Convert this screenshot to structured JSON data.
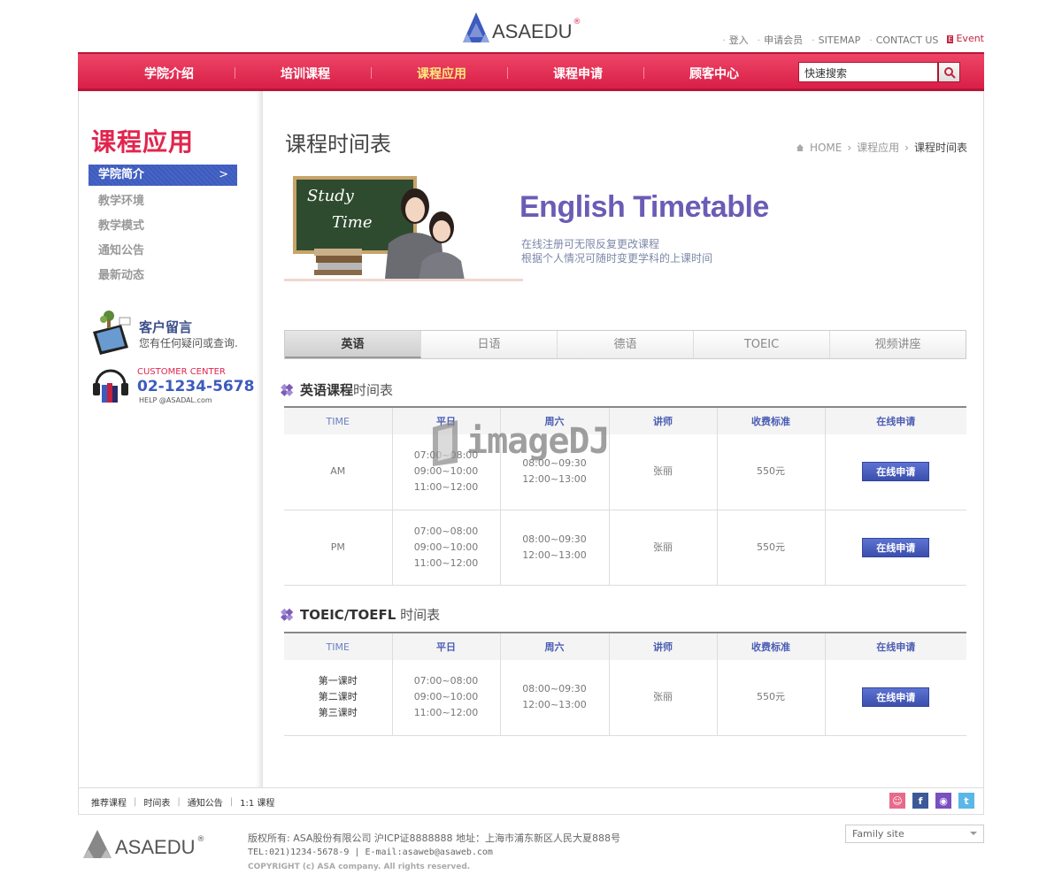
{
  "brand": {
    "name": "ASAEDU",
    "reg": "®"
  },
  "utility": {
    "login": "登入",
    "join": "申请会员",
    "sitemap": "SITEMAP",
    "contact": "CONTACT US",
    "event": "Event"
  },
  "nav": {
    "items": [
      "学院介绍",
      "培训课程",
      "课程应用",
      "课程申请",
      "顾客中心"
    ],
    "active_index": 2,
    "search_placeholder": "快速搜索"
  },
  "sidebar": {
    "title": "课程应用",
    "menu": [
      "学院简介",
      "教学环境",
      "教学模式",
      "通知公告",
      "最新动态"
    ],
    "promo": {
      "title": "客户留言",
      "subtitle": "您有任何疑问或查询."
    },
    "center": {
      "label": "CUSTOMER CENTER",
      "phone": "02-1234-5678",
      "help": "HELP @ASADAL.com"
    }
  },
  "main": {
    "title": "课程时间表",
    "breadcrumb": [
      "HOME",
      "课程应用",
      "课程时间表"
    ],
    "banner": {
      "title": "English Timetable",
      "line1": "在线注册可无限反复更改课程",
      "line2": "根据个人情况可随时变更学科的上课时间",
      "board1": "Study",
      "board2": "Time"
    },
    "tabs": [
      "英语",
      "日语",
      "德语",
      "TOEIC",
      "视频讲座"
    ],
    "active_tab": 0,
    "section1": {
      "title_bold": "英语课程",
      "title_lite": "时间表",
      "headers": [
        "TIME",
        "平日",
        "周六",
        "讲师",
        "收费标准",
        "在线申请"
      ],
      "rows": [
        {
          "time": "AM",
          "weekday": [
            "07:00~08:00",
            "09:00~10:00",
            "11:00~12:00"
          ],
          "saturday": [
            "08:00~09:30",
            "12:00~13:00"
          ],
          "teacher": "张丽",
          "fee": "550元",
          "apply": "在线申请"
        },
        {
          "time": "PM",
          "weekday": [
            "07:00~08:00",
            "09:00~10:00",
            "11:00~12:00"
          ],
          "saturday": [
            "08:00~09:30",
            "12:00~13:00"
          ],
          "teacher": "张丽",
          "fee": "550元",
          "apply": "在线申请"
        }
      ]
    },
    "section2": {
      "title_bold": "TOEIC/TOEFL",
      "title_lite": " 时间表",
      "headers": [
        "TIME",
        "平日",
        "周六",
        "讲师",
        "收费标准",
        "在线申请"
      ],
      "rows": [
        {
          "time": [
            "第一课时",
            "第二课时",
            "第三课时"
          ],
          "weekday": [
            "07:00~08:00",
            "09:00~10:00",
            "11:00~12:00"
          ],
          "saturday": [
            "08:00~09:30",
            "12:00~13:00"
          ],
          "teacher": "张丽",
          "fee": "550元",
          "apply": "在线申请"
        }
      ]
    }
  },
  "footer": {
    "links": [
      "推荐课程",
      "时间表",
      "通知公告",
      "1:1 课程"
    ],
    "line1": "版权所有: ASA股份有限公司 沪ICP证8888888 地址：上海市浦东新区人民大夏888号",
    "line2": "TEL:021)1234-5678-9 | E-mail:asaweb@asaweb.com",
    "copyright": "COPYRIGHT (c) ASA company. All rights reserved.",
    "family_site": "Family site"
  },
  "watermark": "imageDJ"
}
